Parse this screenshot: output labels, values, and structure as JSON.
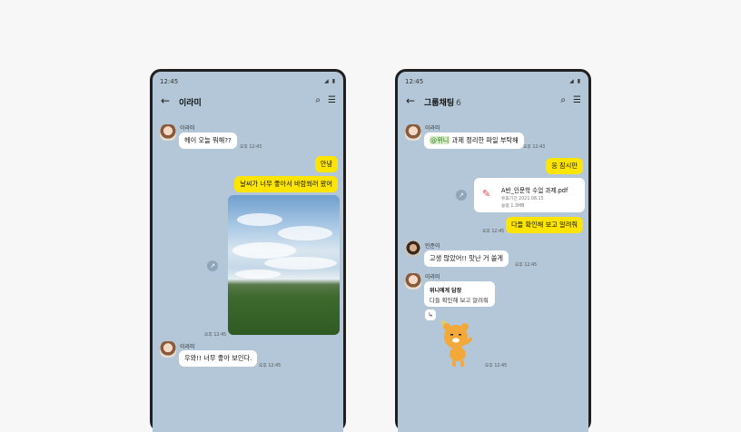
{
  "phone1": {
    "status_time": "12:45",
    "title": "이라미",
    "messages": {
      "m1_name": "이라미",
      "m1_text": "헤이 오늘 뭐해??",
      "m1_time": "오후 12:43",
      "m2_text": "안녕",
      "m3_text": "날씨가 너무 좋아서 바람쐬러 왔어",
      "photo_time": "오후 12:45",
      "m4_name": "이라미",
      "m4_text": "우와!! 너무 좋아 보인다.",
      "m4_time": "오후 12:45"
    }
  },
  "phone2": {
    "status_time": "12:45",
    "title": "그룹채팅",
    "member_count": "6",
    "messages": {
      "m1_name": "이라미",
      "m1_mention": "@위니",
      "m1_text": " 과제 정리한 파일 부탁해",
      "m1_time": "오후 12:43",
      "m2_text": "응 잠시만",
      "file_name": "A반_인문학 수업 과제.pdf",
      "file_expiry": "유효기간  2021.08.15",
      "file_size": "용량  1.3MB",
      "m3_time": "오후 12:45",
      "m3_text": "다들 확인해 보고 알려줘",
      "m4_name": "민준이",
      "m4_text": "고생 많았어!! 맛난 거 쏠게",
      "m4_time": "오후 12:45",
      "m5_name": "이라미",
      "reply_title": "위니에게 답장",
      "reply_text": "다들 확인해 보고 알려줘",
      "sticker_time": "오후 12:45"
    }
  },
  "colors": {
    "chat_bg": "#b3c7d8",
    "my_bubble": "#fee500",
    "other_bubble": "#ffffff"
  },
  "icons": [
    "back-arrow-icon",
    "search-icon",
    "menu-icon",
    "share-icon",
    "pdf-icon",
    "reply-icon"
  ]
}
